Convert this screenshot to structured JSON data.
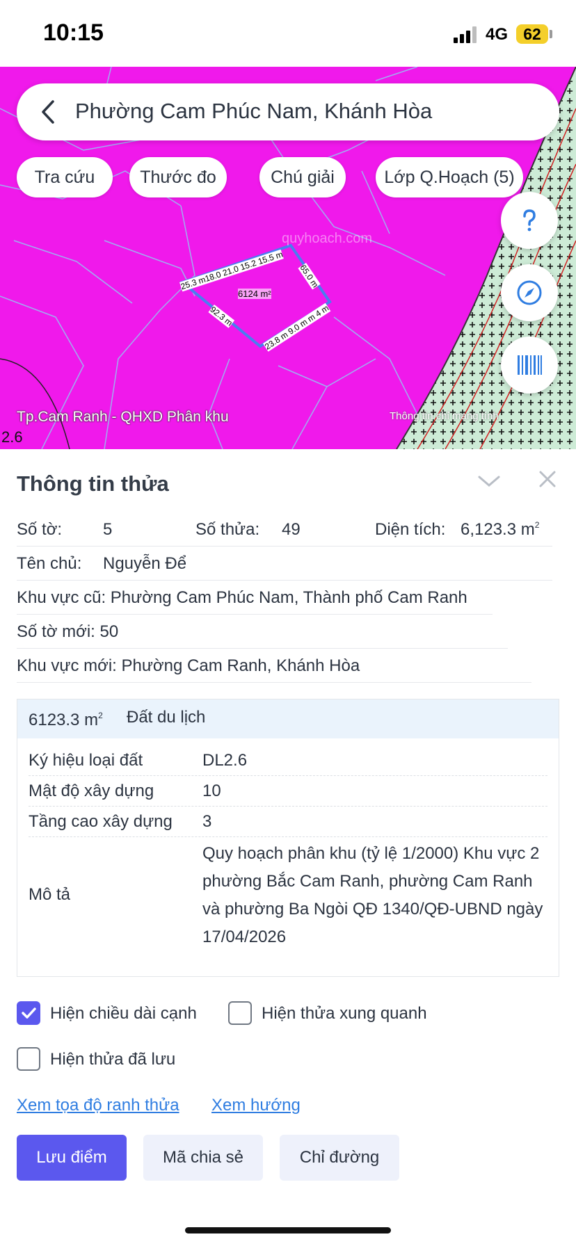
{
  "status": {
    "time": "10:15",
    "network": "4G",
    "battery": "62"
  },
  "search": {
    "text": "Phường Cam Phúc Nam, Khánh Hòa"
  },
  "chips": [
    "Tra cứu",
    "Thước đo",
    "Chú giải",
    "Lớp Q.Hoạch (5)"
  ],
  "map": {
    "caption": "Tp.Cam Ranh - QHXD Phân khu",
    "note": "Thông tin chỉ mang tính",
    "zone_code": "2.6",
    "watermark": "quyhoach.com",
    "parcel_area_label": "6124 m²",
    "edge_labels": [
      "25.3 m18.0 21.0 15.2 15.5 m",
      "65.0 m",
      "23.8 m 9.0 m m 4 m",
      "92.3 m"
    ]
  },
  "panel": {
    "title": "Thông tin thửa",
    "so_to_label": "Số tờ:",
    "so_to": "5",
    "so_thua_label": "Số thửa:",
    "so_thua": "49",
    "dien_tich_label": "Diện tích:",
    "dien_tich": "6,123.3 m",
    "ten_chu_label": "Tên chủ:",
    "ten_chu": "Nguyễn Để",
    "khu_vuc_cu": "Khu vực cũ: Phường Cam Phúc Nam, Thành phố Cam Ranh",
    "so_to_moi": "Số tờ mới: 50",
    "khu_vuc_moi": "Khu vực mới: Phường Cam Ranh, Khánh Hòa"
  },
  "planning": {
    "area": "6123.3 m",
    "land_type": "Đất du lịch",
    "rows": [
      {
        "key": "Ký hiệu loại đất",
        "value": "DL2.6"
      },
      {
        "key": "Mật độ xây dựng",
        "value": "10"
      },
      {
        "key": "Tầng cao xây dựng",
        "value": "3"
      }
    ],
    "desc_key": "Mô tả",
    "desc_value": "Quy hoạch phân khu (tỷ lệ 1/2000) Khu vực 2 phường Bắc Cam Ranh, phường Cam Ranh và phường Ba Ngòi QĐ 1340/QĐ-UBND ngày 17/04/2026"
  },
  "options": {
    "show_edge_length": "Hiện chiều dài cạnh",
    "show_edge_length_checked": true,
    "show_neighbors": "Hiện thửa xung quanh",
    "show_neighbors_checked": false,
    "show_saved": "Hiện thửa đã lưu",
    "show_saved_checked": false
  },
  "links": {
    "coords": "Xem tọa độ ranh thửa",
    "direction": "Xem hướng"
  },
  "buttons": {
    "save": "Lưu điểm",
    "share": "Mã chia sẻ",
    "route": "Chỉ đường"
  },
  "colors": {
    "map_zone": "#f019eb",
    "accent": "#5b58ee",
    "link": "#2f7de1"
  }
}
